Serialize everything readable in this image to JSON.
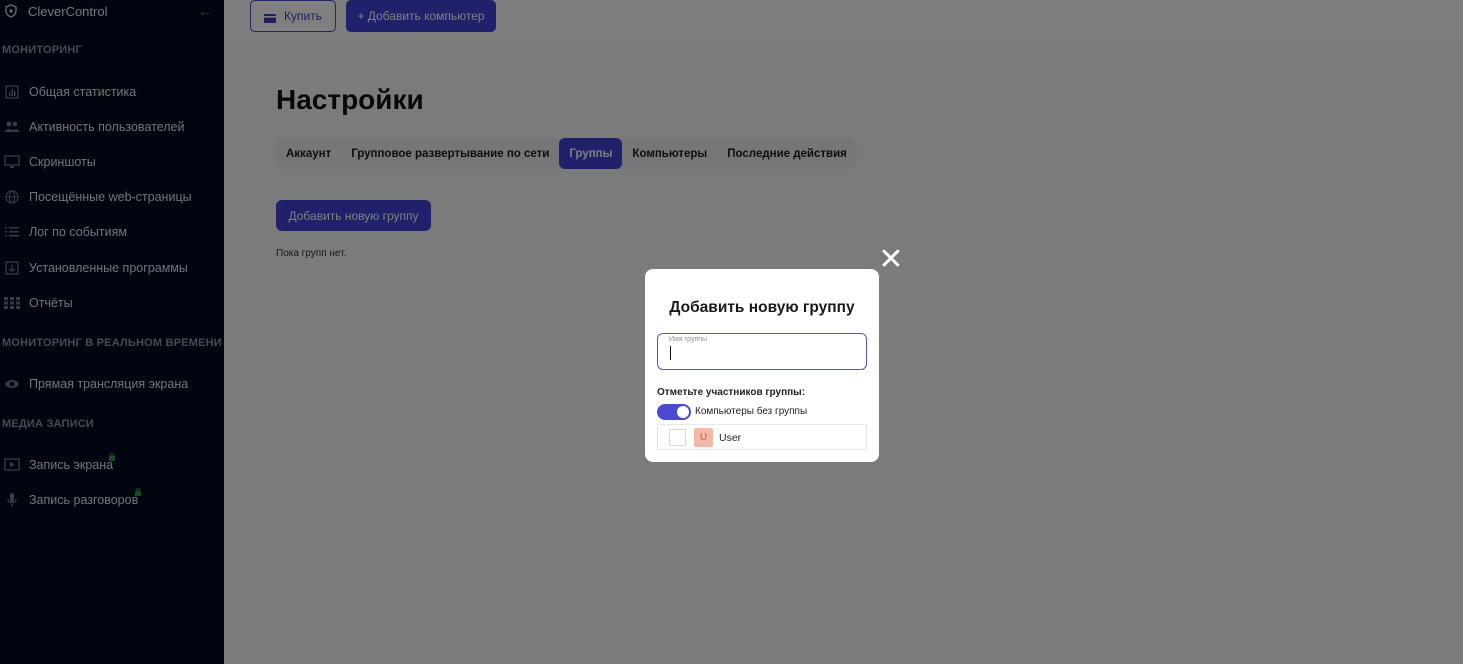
{
  "brand": {
    "name": "CleverControl",
    "logo_icon": "shield-icon",
    "collapse_icon": "arrow-left-icon"
  },
  "sidebar": {
    "sections": [
      {
        "title": "Мониторинг"
      },
      {
        "title": "Мониторинг в реальном времени"
      },
      {
        "title": "Медиа записи"
      }
    ],
    "items": [
      {
        "label": "Общая статистика",
        "icon": "bar-chart-icon"
      },
      {
        "label": "Активность пользователей",
        "icon": "users-icon"
      },
      {
        "label": "Скриншоты",
        "icon": "monitor-icon"
      },
      {
        "label": "Посещённые web-страницы",
        "icon": "globe-icon"
      },
      {
        "label": "Лог по событиям",
        "icon": "list-icon"
      },
      {
        "label": "Установленные программы",
        "icon": "installed-apps-icon"
      },
      {
        "label": "Отчёты",
        "icon": "grid-icon"
      },
      {
        "label": "Прямая трансляция экрана",
        "icon": "eye-icon"
      },
      {
        "label": "Запись экрана",
        "icon": "screen-record-icon",
        "locked": true
      },
      {
        "label": "Запись разговоров",
        "icon": "microphone-icon",
        "locked": true
      }
    ]
  },
  "topbar": {
    "buy_label": "Купить",
    "add_computer_label": "+ Добавить компьютер"
  },
  "page": {
    "title": "Настройки",
    "tabs": [
      {
        "label": "Аккаунт",
        "active": false
      },
      {
        "label": "Групповое развертывание по сети",
        "active": false
      },
      {
        "label": "Группы",
        "active": true
      },
      {
        "label": "Компьютеры",
        "active": false
      },
      {
        "label": "Последние действия",
        "active": false
      }
    ],
    "add_group_label": "Добавить новую группу",
    "empty_text": "Пока групп нет."
  },
  "modal": {
    "title": "Добавить новую группу",
    "name_field_label": "Имя группы",
    "name_field_value": "",
    "members_label": "Отметьте участников группы:",
    "toggle_label": "Компьютеры без группы",
    "toggle_on": true,
    "members": [
      {
        "avatar_letter": "U",
        "name": "User",
        "checked": false
      }
    ]
  },
  "colors": {
    "sidebar_bg": "#020b1f",
    "accent": "#4141d6",
    "overlay": "rgba(0,0,0,0.5)",
    "avatar_bg": "#f3b8a8",
    "lock": "#2e9a3e"
  }
}
